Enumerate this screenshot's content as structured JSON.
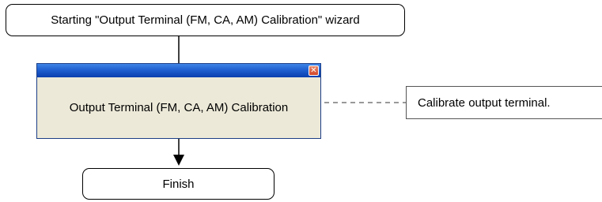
{
  "start_node": {
    "label": "Starting \"Output Terminal (FM, CA, AM) Calibration\" wizard"
  },
  "dialog": {
    "title": "",
    "body_text": "Output Terminal (FM, CA, AM) Calibration",
    "close_icon": "close-icon"
  },
  "note": {
    "text": "Calibrate output terminal."
  },
  "finish_node": {
    "label": "Finish"
  },
  "colors": {
    "titlebar": "#1f5fd0",
    "dialog_body": "#ece9d8",
    "close_button": "#d0452a",
    "line": "#000000"
  }
}
